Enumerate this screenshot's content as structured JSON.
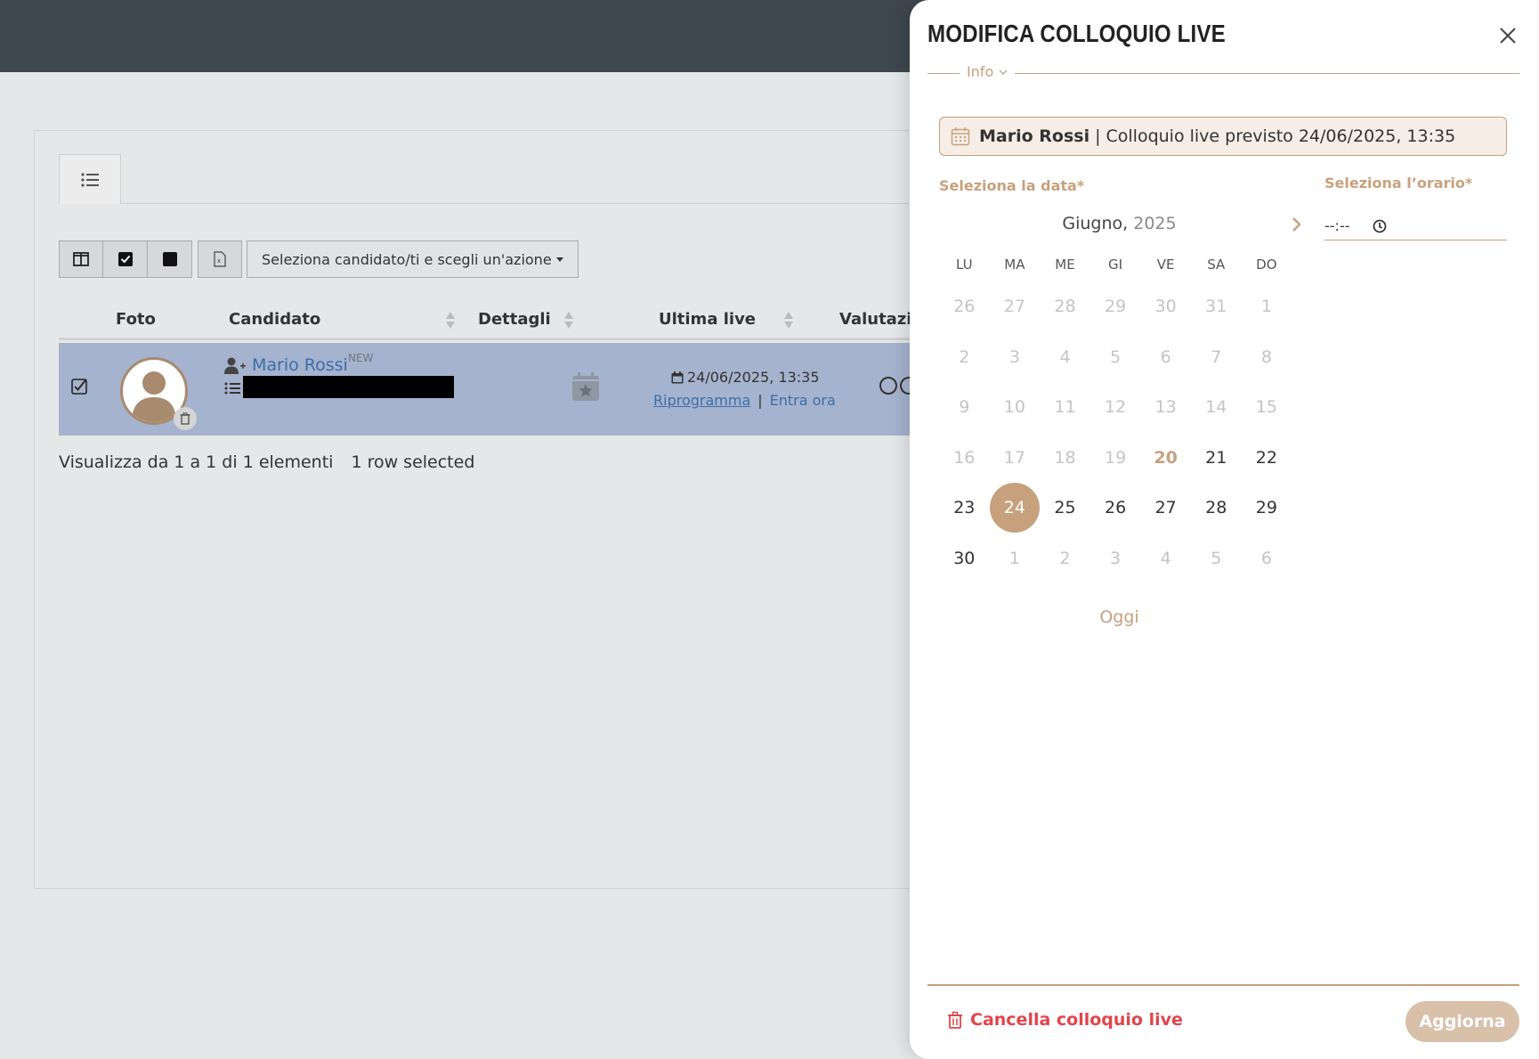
{
  "table": {
    "columns": [
      "Foto",
      "Candidato",
      "Dettagli",
      "Ultima live",
      "Valutazio"
    ],
    "action_select": "Seleziona candidato/ti e scegli un'azione",
    "rows": [
      {
        "name": "Mario Rossi",
        "badge": "NEW",
        "live_date": "24/06/2025, 13:35",
        "reschedule": "Riprogramma",
        "separator": "|",
        "enter_now": "Entra ora"
      }
    ],
    "info_text": "Visualizza da 1 a 1 di 1 elementi",
    "selected_text": "1 row selected"
  },
  "panel": {
    "title": "MODIFICA COLLOQUIO LIVE",
    "section_label": "Info",
    "info_name": "Mario Rossi",
    "info_sep": "|",
    "info_text": "Colloquio live previsto 24/06/2025, 13:35",
    "date_label": "Seleziona la data*",
    "time_label": "Seleziona l’orario*",
    "month": "Giugno,",
    "year": "2025",
    "weekdays": [
      "LU",
      "MA",
      "ME",
      "GI",
      "VE",
      "SA",
      "DO"
    ],
    "weeks": [
      [
        "26",
        "27",
        "28",
        "29",
        "30",
        "31",
        "1"
      ],
      [
        "2",
        "3",
        "4",
        "5",
        "6",
        "7",
        "8"
      ],
      [
        "9",
        "10",
        "11",
        "12",
        "13",
        "14",
        "15"
      ],
      [
        "16",
        "17",
        "18",
        "19",
        "20",
        "21",
        "22"
      ],
      [
        "23",
        "24",
        "25",
        "26",
        "27",
        "28",
        "29"
      ],
      [
        "30",
        "1",
        "2",
        "3",
        "4",
        "5",
        "6"
      ]
    ],
    "today_button": "Oggi",
    "time_placeholder": "--:--",
    "delete_label": "Cancella colloquio live",
    "update_label": "Aggiorna"
  },
  "colors": {
    "accent": "#c7a17d",
    "danger": "#e0454b",
    "topbar": "#3e464f",
    "row_selected": "#a6b3ce",
    "link": "#3b6ea8"
  }
}
